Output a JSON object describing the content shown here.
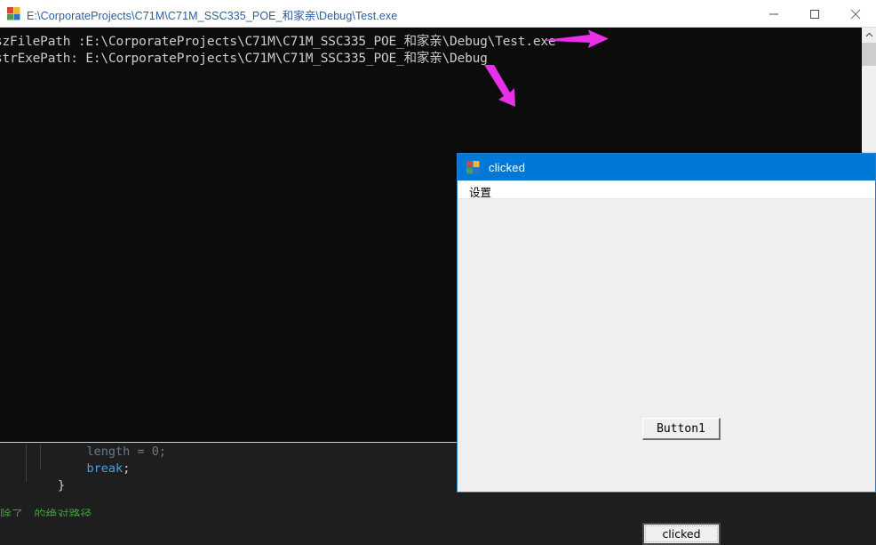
{
  "console_window": {
    "icon": "app-blocks-icon",
    "title": "E:\\CorporateProjects\\C71M\\C71M_SSC335_POE_和家亲\\Debug\\Test.exe",
    "title_color": "#2c5f9e",
    "background": "#0c0c0c",
    "text_color": "#cccccc",
    "controls": {
      "minimize": "minimize-icon",
      "maximize": "maximize-icon",
      "close": "close-icon"
    },
    "output_lines": [
      "szFilePath :E:\\CorporateProjects\\C71M\\C71M_SSC335_POE_和家亲\\Debug\\Test.exe",
      "strExePath: E:\\CorporateProjects\\C71M\\C71M_SSC335_POE_和家亲\\Debug"
    ],
    "scrollbar": {
      "up_arrow": "chevron-up-icon",
      "thumb": "scroll-thumb"
    }
  },
  "annotations": {
    "color": "#e830e8",
    "arrow_right": "arrow-right-annotation",
    "arrow_diagonal": "arrow-down-right-annotation"
  },
  "dialog": {
    "icon": "app-blocks-icon",
    "title": "clicked",
    "titlebar_color": "#0078d7",
    "border_color": "#2b7cd3",
    "body_color": "#efefef",
    "menu": [
      {
        "label": "设置"
      }
    ],
    "buttons": [
      {
        "label": "Button1",
        "state": "normal"
      },
      {
        "label": "clicked",
        "state": "focused"
      }
    ]
  },
  "editor_background": {
    "background": "#1e1e1e",
    "lines": [
      {
        "segments": [
          {
            "text": "            ",
            "cls": "tok-plain"
          },
          {
            "text": "length",
            "cls": "tok-dim"
          },
          {
            "text": " = ",
            "cls": "tok-dim"
          },
          {
            "text": "0",
            "cls": "tok-dim"
          },
          {
            "text": ";",
            "cls": "tok-dim"
          }
        ]
      },
      {
        "segments": [
          {
            "text": "            ",
            "cls": "tok-plain"
          },
          {
            "text": "break",
            "cls": "tok-kw"
          },
          {
            "text": ";",
            "cls": "tok-punc"
          }
        ]
      },
      {
        "segments": [
          {
            "text": "        }",
            "cls": "tok-punc"
          }
        ]
      },
      {
        "segments": [
          {
            "text": "",
            "cls": "tok-plain"
          }
        ]
      },
      {
        "segments": [
          {
            "text": "除了...的绝对路径",
            "cls": "tok-comment"
          }
        ]
      }
    ]
  }
}
